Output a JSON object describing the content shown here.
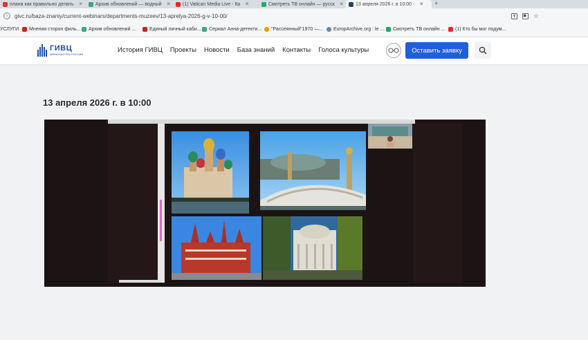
{
  "browser": {
    "tabs": [
      {
        "label": "плана как правильно делать",
        "color": "#d33"
      },
      {
        "label": "Архив обновлений — водный",
        "color": "#3a8"
      },
      {
        "label": "(1) Vatican Media Live - Ita",
        "color": "#e22"
      },
      {
        "label": "Смотреть ТВ онлайн — русск",
        "color": "#2a6"
      },
      {
        "label": "13 апреля 2026 г. в 10:00 -",
        "color": "#246"
      }
    ],
    "url": "givc.ru/baza-znaniy/current-webinars/departments-muzeev/13-aprelya-2026-g-v-10-00/",
    "bookmarks": [
      {
        "label": "УСЛУГИ",
        "color": "#2a6"
      },
      {
        "label": "Мнения сторон филь...",
        "color": "#c22"
      },
      {
        "label": "Архив обновлений ...",
        "color": "#3a8"
      },
      {
        "label": "Единый личный каби...",
        "color": "#c22"
      },
      {
        "label": "Сериал Анна-детекти...",
        "color": "#3a8"
      },
      {
        "label": "\"Рассеянный\"1970 —...",
        "color": "#e90"
      },
      {
        "label": "EuropArchive.org : le ...",
        "color": "#68a"
      },
      {
        "label": "Смотреть ТВ онлайн ...",
        "color": "#2a6"
      },
      {
        "label": "(1) Кто бы мог подум...",
        "color": "#e22"
      }
    ]
  },
  "site": {
    "logo_title": "ГИВЦ",
    "logo_sub": "МИНКУЛЬТУРЫ РОССИИ",
    "nav": [
      "История ГИВЦ",
      "Проекты",
      "Новости",
      "База знаний",
      "Контакты",
      "Голоса культуры"
    ],
    "cta_label": "Оставить заявку",
    "accent": "#1f5fd9"
  },
  "page": {
    "title": "13 апреля 2026 г. в 10:00"
  },
  "video": {
    "thumbnails": [
      "cathedral-st-petersburg",
      "paris-bridge",
      "moscow-history-museum",
      "classical-mansion"
    ]
  }
}
